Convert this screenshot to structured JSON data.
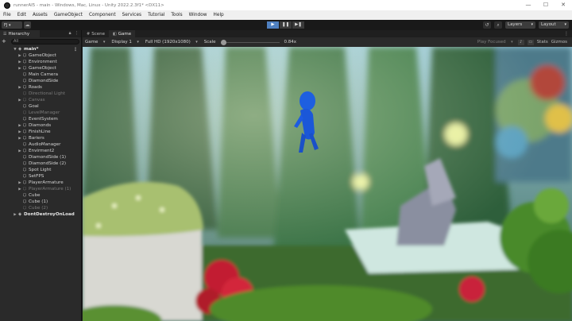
{
  "window": {
    "title": "runnerAI5 - main - Windows, Mac, Linux - Unity 2022.2.3f1* <DX11>",
    "controls": [
      "—",
      "☐",
      "✕"
    ]
  },
  "menu": [
    "File",
    "Edit",
    "Assets",
    "GameObject",
    "Component",
    "Services",
    "Tutorial",
    "Tools",
    "Window",
    "Help"
  ],
  "toolbar": {
    "account": "FJ ▾",
    "play": "▶",
    "pause": "❚❚",
    "step": "▶❚",
    "layers": "Layers",
    "layout": "Layout"
  },
  "hierarchy": {
    "tab_label": "Hierarchy",
    "search_placeholder": "All",
    "add_label": "+",
    "items": [
      {
        "label": "main*",
        "indent": 0,
        "arrow": "▼",
        "type": "scene"
      },
      {
        "label": "GameObject",
        "indent": 1,
        "arrow": "▶",
        "type": "normal"
      },
      {
        "label": "Environment",
        "indent": 1,
        "arrow": "▶",
        "type": "normal"
      },
      {
        "label": "GameObject",
        "indent": 1,
        "arrow": "▶",
        "type": "normal"
      },
      {
        "label": "Main Camera",
        "indent": 1,
        "arrow": "",
        "type": "normal"
      },
      {
        "label": "DiamondSide",
        "indent": 1,
        "arrow": "",
        "type": "normal"
      },
      {
        "label": "Roads",
        "indent": 1,
        "arrow": "▶",
        "type": "normal"
      },
      {
        "label": "Directional Light",
        "indent": 1,
        "arrow": "",
        "type": "inactive"
      },
      {
        "label": "Canvas",
        "indent": 1,
        "arrow": "▶",
        "type": "inactive"
      },
      {
        "label": "Goal",
        "indent": 1,
        "arrow": "",
        "type": "normal"
      },
      {
        "label": "LevelManager",
        "indent": 1,
        "arrow": "",
        "type": "inactive"
      },
      {
        "label": "EventSystem",
        "indent": 1,
        "arrow": "",
        "type": "normal"
      },
      {
        "label": "Diamonds",
        "indent": 1,
        "arrow": "▶",
        "type": "normal"
      },
      {
        "label": "FinishLine",
        "indent": 1,
        "arrow": "▶",
        "type": "normal"
      },
      {
        "label": "Bariers",
        "indent": 1,
        "arrow": "▶",
        "type": "normal"
      },
      {
        "label": "AudioManager",
        "indent": 1,
        "arrow": "",
        "type": "normal"
      },
      {
        "label": "Envirment2",
        "indent": 1,
        "arrow": "▶",
        "type": "normal"
      },
      {
        "label": "DiamondSide (1)",
        "indent": 1,
        "arrow": "",
        "type": "normal"
      },
      {
        "label": "DiamondSide (2)",
        "indent": 1,
        "arrow": "",
        "type": "normal"
      },
      {
        "label": "Spot Light",
        "indent": 1,
        "arrow": "",
        "type": "normal"
      },
      {
        "label": "SetFPS",
        "indent": 1,
        "arrow": "",
        "type": "normal"
      },
      {
        "label": "PlayerArmature",
        "indent": 1,
        "arrow": "▶",
        "type": "normal"
      },
      {
        "label": "PlayerArmature (1)",
        "indent": 1,
        "arrow": "▶",
        "type": "inactive"
      },
      {
        "label": "Cube",
        "indent": 1,
        "arrow": "",
        "type": "normal"
      },
      {
        "label": "Cube (1)",
        "indent": 1,
        "arrow": "",
        "type": "normal"
      },
      {
        "label": "Cube (2)",
        "indent": 1,
        "arrow": "",
        "type": "inactive"
      },
      {
        "label": "DontDestroyOnLoad",
        "indent": 0,
        "arrow": "▶",
        "type": "scene-dd"
      }
    ]
  },
  "view": {
    "tabs": [
      {
        "label": "Scene",
        "icon": "#",
        "active": false
      },
      {
        "label": "Game",
        "icon": "◧",
        "active": true
      }
    ],
    "game_bar": {
      "mode": "Game",
      "display": "Display 1",
      "resolution": "Full HD (1920x1080)",
      "scale_label": "Scale",
      "scale_value": "0.84x",
      "play_focus": "Play Focused",
      "stats": "Stats",
      "gizmos": "Gizmos"
    }
  }
}
